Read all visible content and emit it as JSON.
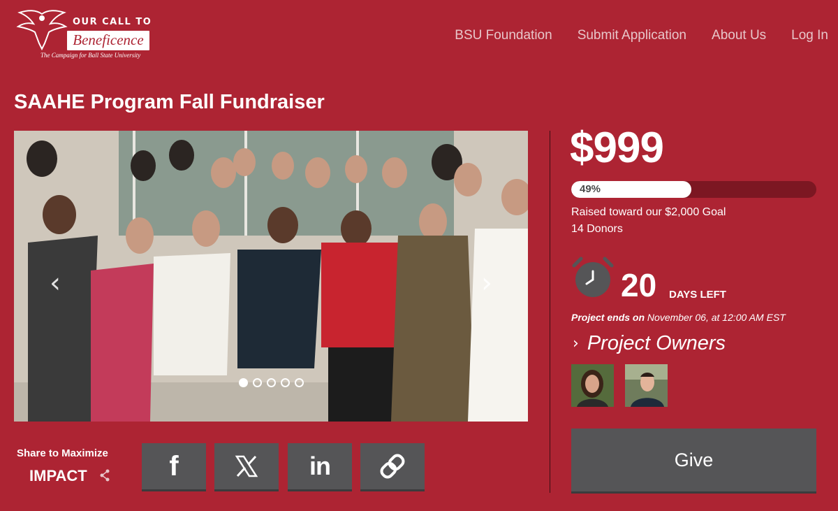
{
  "brand": {
    "logo_line1": "OUR CALL TO",
    "logo_line2": "Beneficence",
    "logo_line3": "The Campaign for Ball State University"
  },
  "nav": {
    "items": [
      "BSU Foundation",
      "Submit Application",
      "About Us",
      "Log In"
    ]
  },
  "page": {
    "title": "SAAHE Program Fall Fundraiser"
  },
  "carousel": {
    "slide_count": 5,
    "active_slide": 1,
    "prev_icon": "chevron-left-icon",
    "next_icon": "chevron-right-icon"
  },
  "fundraiser": {
    "amount": "$999",
    "progress_label": "49%",
    "progress_fraction": 0.49,
    "goal_text": "Raised toward our $2,000 Goal",
    "donors_text": "14 Donors",
    "days_left_number": "20",
    "days_left_label": "DAYS LEFT",
    "ends_prefix": "Project ends on",
    "ends_date": "November 06, at 12:00 AM EST",
    "owners_label": "Project Owners",
    "give_label": "Give"
  },
  "share": {
    "title": "Share to Maximize",
    "impact": "IMPACT",
    "buttons": [
      "facebook-icon",
      "x-icon",
      "linkedin-icon",
      "link-icon"
    ]
  },
  "colors": {
    "background": "#ad2433",
    "button": "#555557",
    "progress_track": "#7c1722"
  }
}
